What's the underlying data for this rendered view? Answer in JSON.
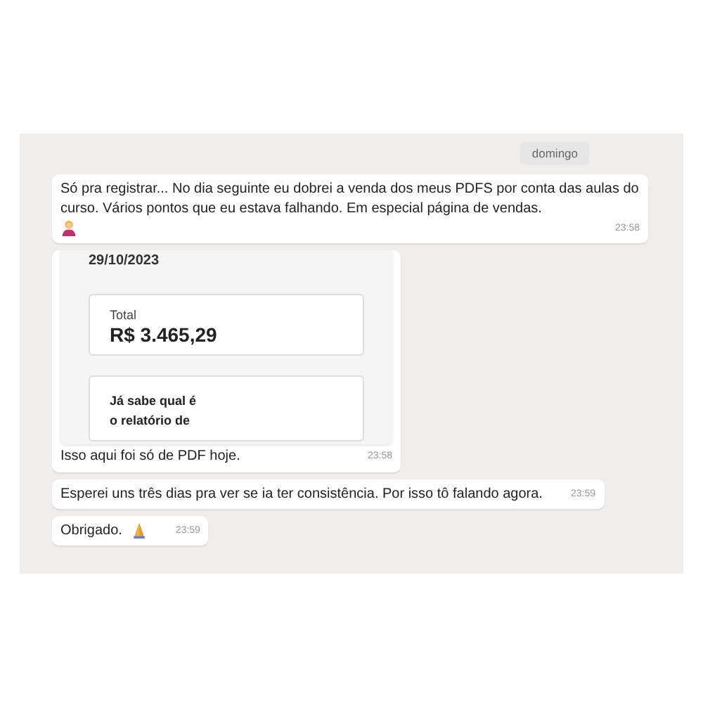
{
  "date_chip": "domingo",
  "messages": [
    {
      "kind": "text",
      "text": "Só pra registrar... No dia seguinte eu dobrei a venda dos meus PDFS por conta das aulas do curso. Vários pontos que eu estava falhando. Em especial página de vendas.",
      "emoji": {
        "kind": "person"
      },
      "time": "23:58"
    },
    {
      "kind": "image",
      "image": {
        "date": "29/10/2023",
        "total_label": "Total",
        "total_value": "R$ 3.465,29",
        "promo_lines": [
          "Já sabe qual é",
          "o relatório de"
        ]
      },
      "text": "Isso aqui foi só de PDF hoje.",
      "time": "23:58"
    },
    {
      "kind": "text",
      "text": "Esperei uns três dias pra ver se ia ter consistência. Por isso tô falando agora.",
      "time": "23:59"
    },
    {
      "kind": "text",
      "text": "Obrigado.",
      "emoji": {
        "kind": "pray"
      },
      "time": "23:59"
    }
  ]
}
